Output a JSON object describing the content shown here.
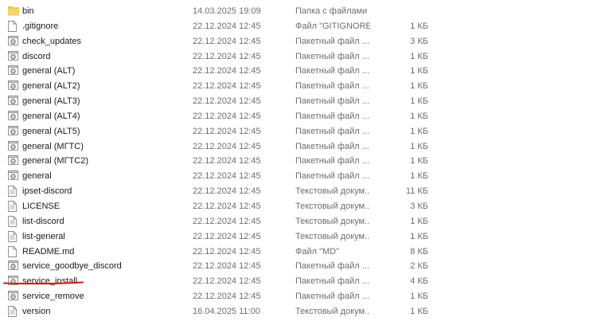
{
  "files": [
    {
      "name": "bin",
      "date": "14.03.2025 19:09",
      "type": "Папка с файлами",
      "size": "",
      "icon": "folder-icon"
    },
    {
      "name": ".gitignore",
      "date": "22.12.2024 12:45",
      "type": "Файл \"GITIGNORE\"",
      "size": "1 КБ",
      "icon": "file-icon"
    },
    {
      "name": "check_updates",
      "date": "22.12.2024 12:45",
      "type": "Пакетный файл ...",
      "size": "3 КБ",
      "icon": "batch-file-icon"
    },
    {
      "name": "discord",
      "date": "22.12.2024 12:45",
      "type": "Пакетный файл ...",
      "size": "1 КБ",
      "icon": "batch-file-icon"
    },
    {
      "name": "general (ALT)",
      "date": "22.12.2024 12:45",
      "type": "Пакетный файл ...",
      "size": "1 КБ",
      "icon": "batch-file-icon"
    },
    {
      "name": "general (ALT2)",
      "date": "22.12.2024 12:45",
      "type": "Пакетный файл ...",
      "size": "1 КБ",
      "icon": "batch-file-icon"
    },
    {
      "name": "general (ALT3)",
      "date": "22.12.2024 12:45",
      "type": "Пакетный файл ...",
      "size": "1 КБ",
      "icon": "batch-file-icon"
    },
    {
      "name": "general (ALT4)",
      "date": "22.12.2024 12:45",
      "type": "Пакетный файл ...",
      "size": "1 КБ",
      "icon": "batch-file-icon"
    },
    {
      "name": "general (ALT5)",
      "date": "22.12.2024 12:45",
      "type": "Пакетный файл ...",
      "size": "1 КБ",
      "icon": "batch-file-icon"
    },
    {
      "name": "general (МГТС)",
      "date": "22.12.2024 12:45",
      "type": "Пакетный файл ...",
      "size": "1 КБ",
      "icon": "batch-file-icon"
    },
    {
      "name": "general (МГТС2)",
      "date": "22.12.2024 12:45",
      "type": "Пакетный файл ...",
      "size": "1 КБ",
      "icon": "batch-file-icon"
    },
    {
      "name": "general",
      "date": "22.12.2024 12:45",
      "type": "Пакетный файл ...",
      "size": "1 КБ",
      "icon": "batch-file-icon"
    },
    {
      "name": "ipset-discord",
      "date": "22.12.2024 12:45",
      "type": "Текстовый докум...",
      "size": "11 КБ",
      "icon": "text-file-icon"
    },
    {
      "name": "LICENSE",
      "date": "22.12.2024 12:45",
      "type": "Текстовый докум...",
      "size": "3 КБ",
      "icon": "text-file-icon"
    },
    {
      "name": "list-discord",
      "date": "22.12.2024 12:45",
      "type": "Текстовый докум...",
      "size": "1 КБ",
      "icon": "text-file-icon"
    },
    {
      "name": "list-general",
      "date": "22.12.2024 12:45",
      "type": "Текстовый докум...",
      "size": "1 КБ",
      "icon": "text-file-icon"
    },
    {
      "name": "README.md",
      "date": "22.12.2024 12:45",
      "type": "Файл \"MD\"",
      "size": "8 КБ",
      "icon": "file-icon"
    },
    {
      "name": "service_goodbye_discord",
      "date": "22.12.2024 12:45",
      "type": "Пакетный файл ...",
      "size": "2 КБ",
      "icon": "batch-file-icon"
    },
    {
      "name": "service_install",
      "date": "22.12.2024 12:45",
      "type": "Пакетный файл ...",
      "size": "4 КБ",
      "icon": "batch-file-icon"
    },
    {
      "name": "service_remove",
      "date": "22.12.2024 12:45",
      "type": "Пакетный файл ...",
      "size": "1 КБ",
      "icon": "batch-file-icon"
    },
    {
      "name": "version",
      "date": "16.04.2025 11:00",
      "type": "Текстовый докум...",
      "size": "1 КБ",
      "icon": "text-file-icon"
    }
  ],
  "annotation": {
    "kind": "red-underline",
    "target": "service_install",
    "color": "#d01818"
  },
  "colors": {
    "folder": "#f2c94c",
    "folder_tab": "#e0b13a",
    "batch_gear": "#7a7a7a",
    "text_muted": "#6d6d6d"
  }
}
